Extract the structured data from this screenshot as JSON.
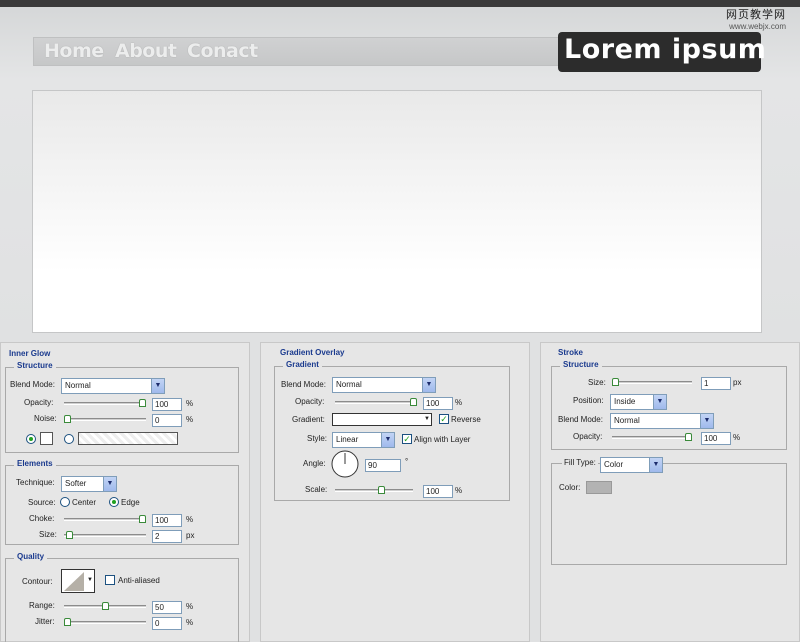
{
  "watermark": {
    "cn": "网页教学网",
    "url": "www.webjx.com"
  },
  "nav": {
    "items": [
      "Home",
      "About",
      "Conact"
    ]
  },
  "logo": {
    "text": "Lorem ipsum"
  },
  "inner_glow": {
    "title": "Inner Glow",
    "structure": {
      "title": "Structure",
      "blend_mode_label": "Blend Mode:",
      "blend_mode": "Normal",
      "opacity_label": "Opacity:",
      "opacity": "100",
      "opacity_unit": "%",
      "noise_label": "Noise:",
      "noise": "0",
      "noise_unit": "%"
    },
    "elements": {
      "title": "Elements",
      "technique_label": "Technique:",
      "technique": "Softer",
      "source_label": "Source:",
      "source_center": "Center",
      "source_edge": "Edge",
      "choke_label": "Choke:",
      "choke": "100",
      "choke_unit": "%",
      "size_label": "Size:",
      "size": "2",
      "size_unit": "px"
    },
    "quality": {
      "title": "Quality",
      "contour_label": "Contour:",
      "anti_aliased": "Anti-aliased",
      "range_label": "Range:",
      "range": "50",
      "range_unit": "%",
      "jitter_label": "Jitter:",
      "jitter": "0",
      "jitter_unit": "%"
    }
  },
  "gradient_overlay": {
    "title": "Gradient Overlay",
    "gradient": {
      "title": "Gradient",
      "blend_mode_label": "Blend Mode:",
      "blend_mode": "Normal",
      "opacity_label": "Opacity:",
      "opacity": "100",
      "opacity_unit": "%",
      "gradient_label": "Gradient:",
      "reverse": "Reverse",
      "style_label": "Style:",
      "style": "Linear",
      "align": "Align with Layer",
      "angle_label": "Angle:",
      "angle": "90",
      "angle_unit": "°",
      "scale_label": "Scale:",
      "scale": "100",
      "scale_unit": "%"
    }
  },
  "stroke": {
    "title": "Stroke",
    "structure": {
      "title": "Structure",
      "size_label": "Size:",
      "size": "1",
      "size_unit": "px",
      "position_label": "Position:",
      "position": "Inside",
      "blend_mode_label": "Blend Mode:",
      "blend_mode": "Normal",
      "opacity_label": "Opacity:",
      "opacity": "100",
      "opacity_unit": "%"
    },
    "fill": {
      "fill_type_label": "Fill Type:",
      "fill_type": "Color",
      "color_label": "Color:",
      "color": "#b3b3b3"
    }
  },
  "colors": {
    "legend": "#1a3a8e",
    "logo_bg": "#2c2c2c",
    "check": "#21a121"
  },
  "slider_levels": {
    "ig_opacity": 1.0,
    "ig_noise": 0.0,
    "ig_choke": 1.0,
    "ig_size": 0.02,
    "ig_range": 0.5,
    "ig_jitter": 0.0,
    "go_opacity": 1.0,
    "go_scale": 0.6,
    "st_size": 0.0,
    "st_opacity": 1.0
  }
}
